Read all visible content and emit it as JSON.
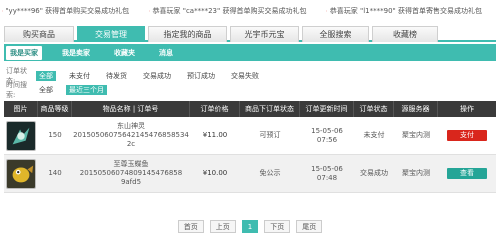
{
  "ticker": [
    "\"yy****96\"  获得首单购买交易成功礼包",
    "恭喜玩家 \"ca****23\"  获得首单购买交易成功礼包",
    "恭喜玩家 \"l1****90\"  获得首单寄售交易成功礼包"
  ],
  "tabs": [
    {
      "label": "购买商品",
      "width": 70
    },
    {
      "label": "交易管理",
      "width": 68
    },
    {
      "label": "指定我的商品",
      "width": 79
    },
    {
      "label": "光宇币元宝",
      "width": 69
    },
    {
      "label": "全服搜索",
      "width": 67
    },
    {
      "label": "收藏榜",
      "width": 66
    }
  ],
  "subnav": [
    "我是买家",
    "我是卖家",
    "收藏夹",
    "消息"
  ],
  "filters": {
    "status_label": "订单状态:",
    "status_options": [
      "全部",
      "未支付",
      "待发货",
      "交易成功",
      "预订成功",
      "交易失败"
    ],
    "time_label": "时间搜索:",
    "time_options": [
      "全部",
      "最近三个月"
    ]
  },
  "table": {
    "headers": [
      "图片",
      "商品等级",
      "物品名称 | 订单号",
      "订单价格",
      "商品下订单状态",
      "订单更新时间",
      "订单状态",
      "源服务器",
      "操作"
    ],
    "rows": [
      {
        "level": "150",
        "name": "东山神灵",
        "order": "20150506075642145476858534​2c",
        "price": "¥11.00",
        "item_status": "可预订",
        "date": "15-05-06",
        "time": "07:56",
        "status": "未支付",
        "server": "聚宝内测",
        "action": "支付"
      },
      {
        "level": "140",
        "name": "至尊玉蝶鱼",
        "order": "20150506074809145476858​9afd5",
        "price": "¥10.00",
        "item_status": "免公示",
        "date": "15-05-06",
        "time": "07:48",
        "status": "交易成功",
        "server": "聚宝内测",
        "action": "查看"
      }
    ]
  },
  "pager": [
    "首页",
    "上页",
    "1",
    "下页",
    "尾页"
  ],
  "colors": {
    "accent": "#3fbcb0",
    "header": "#3a3a3a",
    "pay": "#d9261c"
  }
}
